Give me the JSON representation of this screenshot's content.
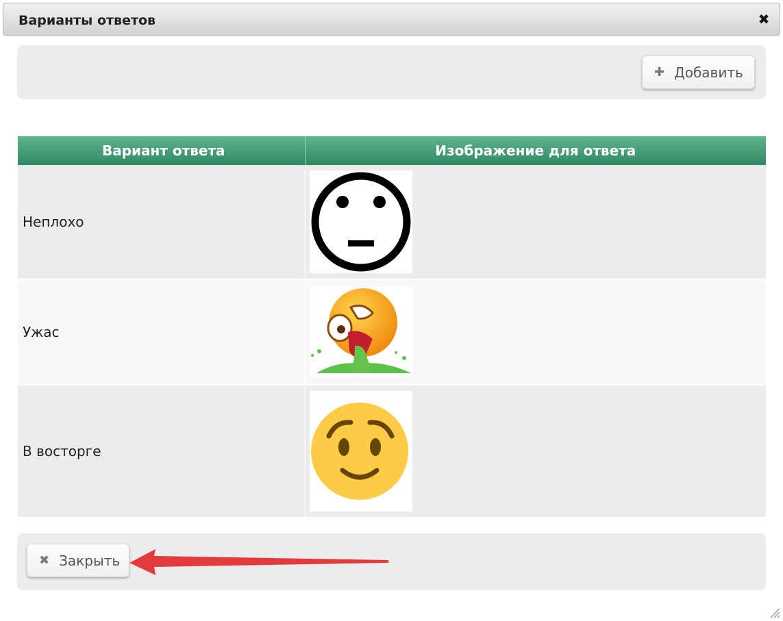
{
  "dialog": {
    "title": "Варианты ответов",
    "close_icon": "close-icon",
    "add_button": {
      "label": "Добавить",
      "icon": "plus-icon"
    },
    "close_button": {
      "label": "Закрыть",
      "icon": "x-icon"
    }
  },
  "table": {
    "columns": [
      "Вариант ответа",
      "Изображение для ответа"
    ],
    "rows": [
      {
        "answer": "Неплохо",
        "image": "neutral-face-outline-icon"
      },
      {
        "answer": "Ужас",
        "image": "vomiting-face-emoji-icon"
      },
      {
        "answer": "В восторге",
        "image": "relieved-face-emoji-icon"
      }
    ]
  },
  "colors": {
    "header_green": "#3e9a72",
    "panel_gray": "#ececec",
    "arrow_red": "#e23b3b"
  }
}
